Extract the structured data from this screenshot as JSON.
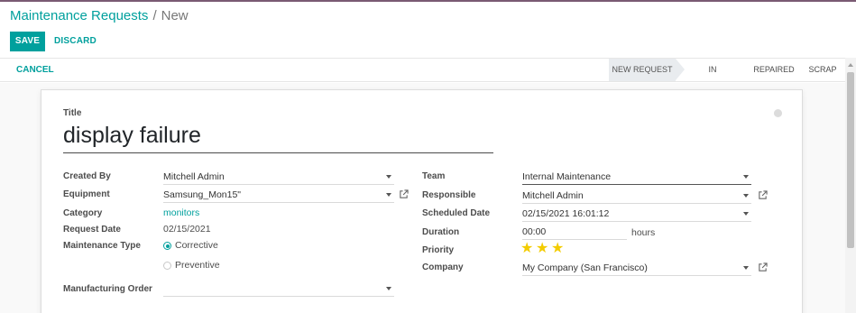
{
  "breadcrumb": {
    "root": "Maintenance Requests",
    "separator": "/",
    "current": "New"
  },
  "toolbar": {
    "save_label": "SAVE",
    "discard_label": "DISCARD"
  },
  "statusbar": {
    "cancel_label": "CANCEL",
    "stages": [
      {
        "label": "NEW REQUEST",
        "active": true
      },
      {
        "label": "IN PROGRESS",
        "active": false
      },
      {
        "label": "REPAIRED",
        "active": false
      },
      {
        "label": "SCRAP",
        "active": false
      }
    ]
  },
  "form": {
    "title_label": "Title",
    "title_value": "display failure",
    "left": {
      "created_by": {
        "label": "Created By",
        "value": "Mitchell Admin"
      },
      "equipment": {
        "label": "Equipment",
        "value": "Samsung_Mon15\""
      },
      "category": {
        "label": "Category",
        "value": "monitors"
      },
      "request_date": {
        "label": "Request Date",
        "value": "02/15/2021"
      },
      "maintenance_type": {
        "label": "Maintenance Type",
        "options": [
          {
            "label": "Corrective",
            "selected": true
          },
          {
            "label": "Preventive",
            "selected": false
          }
        ]
      },
      "manufacturing_order": {
        "label": "Manufacturing Order",
        "value": ""
      }
    },
    "right": {
      "team": {
        "label": "Team",
        "value": "Internal Maintenance"
      },
      "responsible": {
        "label": "Responsible",
        "value": "Mitchell Admin"
      },
      "scheduled_date": {
        "label": "Scheduled Date",
        "value": "02/15/2021 16:01:12"
      },
      "duration": {
        "label": "Duration",
        "value": "00:00",
        "unit": "hours"
      },
      "priority": {
        "label": "Priority",
        "stars_filled": 3,
        "stars_total": 3
      },
      "company": {
        "label": "Company",
        "value": "My Company (San Francisco)"
      }
    }
  },
  "colors": {
    "accent": "#00a09d",
    "star": "#f3cc00",
    "topline": "#7a5a73"
  },
  "icons": {
    "dropdown": "caret-down-icon",
    "external": "external-link-icon",
    "star": "star-icon"
  }
}
